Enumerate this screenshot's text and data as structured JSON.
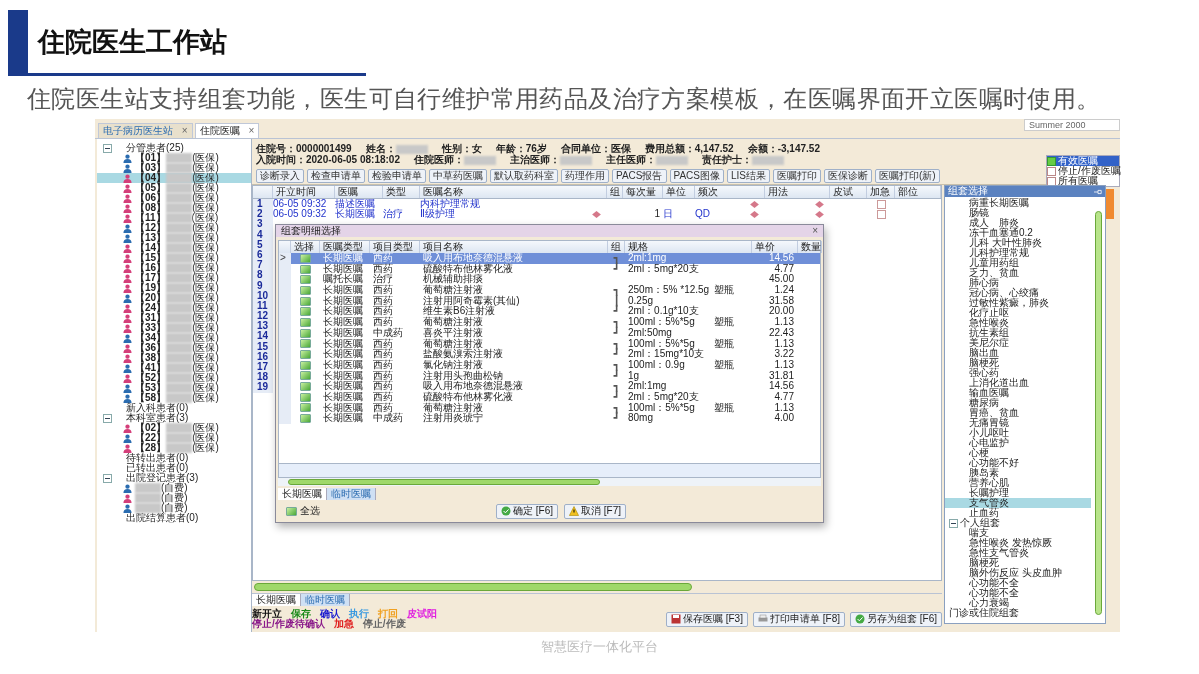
{
  "slide": {
    "title": "住院医生工作站",
    "subtitle": "住院医生站支持组套功能，医生可自行维护常用药品及治疗方案模板，在医嘱界面开立医嘱时使用。",
    "caption": "智慧医疗一体化平台"
  },
  "app": {
    "tabs": [
      {
        "label": "电子病历医生站",
        "close": "×",
        "selected": false
      },
      {
        "label": "住院医嘱",
        "close": "×",
        "selected": true
      }
    ],
    "theme_field": "Summer 2000",
    "patient_tree": [
      {
        "label": "分管患者(25)",
        "expanded": true,
        "children": [
          {
            "id": "【01】",
            "fee": "(医保)",
            "color": "#2b6cb0",
            "selected": false
          },
          {
            "id": "【03】",
            "fee": "(医保)",
            "color": "#2b6cb0",
            "selected": false
          },
          {
            "id": "【04】",
            "fee": "(医保)",
            "color": "#d43f7a",
            "selected": true
          },
          {
            "id": "【05】",
            "fee": "(医保)",
            "color": "#d43f7a",
            "selected": false
          },
          {
            "id": "【06】",
            "fee": "(医保)",
            "color": "#d43f7a",
            "selected": false
          },
          {
            "id": "【08】",
            "fee": "(医保)",
            "color": "#d43f7a",
            "selected": false
          },
          {
            "id": "【11】",
            "fee": "(医保)",
            "color": "#d43f7a",
            "selected": false
          },
          {
            "id": "【12】",
            "fee": "(医保)",
            "color": "#2b6cb0",
            "selected": false
          },
          {
            "id": "【13】",
            "fee": "(医保)",
            "color": "#2b6cb0",
            "selected": false
          },
          {
            "id": "【14】",
            "fee": "(医保)",
            "color": "#d43f7a",
            "selected": false
          },
          {
            "id": "【15】",
            "fee": "(医保)",
            "color": "#d43f7a",
            "selected": false
          },
          {
            "id": "【16】",
            "fee": "(医保)",
            "color": "#d43f7a",
            "selected": false
          },
          {
            "id": "【17】",
            "fee": "(医保)",
            "color": "#d43f7a",
            "selected": false
          },
          {
            "id": "【19】",
            "fee": "(医保)",
            "color": "#d43f7a",
            "selected": false
          },
          {
            "id": "【20】",
            "fee": "(医保)",
            "color": "#2b6cb0",
            "selected": false
          },
          {
            "id": "【24】",
            "fee": "(医保)",
            "color": "#d43f7a",
            "selected": false
          },
          {
            "id": "【31】",
            "fee": "(医保)",
            "color": "#d43f7a",
            "selected": false
          },
          {
            "id": "【33】",
            "fee": "(医保)",
            "color": "#d43f7a",
            "selected": false
          },
          {
            "id": "【34】",
            "fee": "(医保)",
            "color": "#2b6cb0",
            "selected": false
          },
          {
            "id": "【36】",
            "fee": "(医保)",
            "color": "#d43f7a",
            "selected": false
          },
          {
            "id": "【38】",
            "fee": "(医保)",
            "color": "#d43f7a",
            "selected": false
          },
          {
            "id": "【41】",
            "fee": "(医保)",
            "color": "#2b6cb0",
            "selected": false
          },
          {
            "id": "【52】",
            "fee": "(医保)",
            "color": "#d43f7a",
            "selected": false
          },
          {
            "id": "【53】",
            "fee": "(医保)",
            "color": "#2b6cb0",
            "selected": false
          },
          {
            "id": "【58】",
            "fee": "(医保)",
            "color": "#2b6cb0",
            "selected": false
          }
        ]
      },
      {
        "label": "新入科患者(0)"
      },
      {
        "label": "本科室患者(3)",
        "expanded": true,
        "children": [
          {
            "id": "【02】",
            "fee": "(医保)",
            "color": "#d43f7a",
            "selected": false
          },
          {
            "id": "【22】",
            "fee": "(医保)",
            "color": "#2b6cb0",
            "selected": false
          },
          {
            "id": "【28】",
            "fee": "(医保)",
            "color": "#d43f7a",
            "selected": false
          }
        ]
      },
      {
        "label": "待转出患者(0)"
      },
      {
        "label": "已转出患者(0)"
      },
      {
        "label": "出院登记患者(3)",
        "expanded": true,
        "children": [
          {
            "fee": "(自费)",
            "color": "#2b6cb0",
            "selected": false
          },
          {
            "fee": "(自费)",
            "color": "#d43f7a",
            "selected": false
          },
          {
            "fee": "(自费)",
            "color": "#2b6cb0",
            "selected": false
          }
        ]
      },
      {
        "label": "出院结算患者(0)"
      }
    ],
    "patient_info": [
      [
        {
          "label": "住院号：",
          "value": "0000001499"
        },
        {
          "label": "姓名：",
          "blurred": true
        },
        {
          "label": "性别：",
          "value": "女"
        },
        {
          "label": "年龄：",
          "value": "76岁"
        },
        {
          "label": "合同单位：",
          "value": "医保"
        },
        {
          "label": "费用总额：",
          "value": "4,147.52"
        },
        {
          "label": "余额：",
          "value": "-3,147.52"
        }
      ],
      [
        {
          "label": "入院时间：",
          "value": "2020-06-05 08:18:02"
        },
        {
          "label": "住院医师：",
          "blurred": true
        },
        {
          "label": "主治医师：",
          "blurred": true
        },
        {
          "label": "主任医师：",
          "blurred": true
        },
        {
          "label": "责任护士：",
          "blurred": true
        }
      ]
    ],
    "toolbar": [
      "诊断录入",
      "检查申请单",
      "检验申请单",
      "中草药医嘱",
      "默认取药科室",
      "药理作用",
      "PACS报告",
      "PACS图像",
      "LIS结果",
      "医嘱打印",
      "医保诊断",
      "医嘱打印(新)"
    ],
    "order_filters": [
      {
        "label": "有效医嘱",
        "checked": true,
        "selected": true
      },
      {
        "label": "停止/作废医嘱",
        "checked": false,
        "selected": false
      },
      {
        "label": "所有医嘱",
        "checked": false,
        "selected": false
      }
    ],
    "order_grid": {
      "columns": [
        "开立时间",
        "医嘱",
        "类型",
        "医嘱名称",
        "组",
        "每次量",
        "单位",
        "频次",
        "用法",
        "皮试",
        "加急",
        "部位"
      ],
      "rows": [
        {
          "num": "1",
          "time": "06-05 09:32",
          "order_type": "描述医嘱",
          "category": "",
          "name": "内科护理常规",
          "dose": "",
          "unit": "",
          "freq": "",
          "urgent": false
        },
        {
          "num": "2",
          "time": "06-05 09:32",
          "order_type": "长期医嘱",
          "category": "治疗",
          "name": "Ⅱ级护理",
          "dose": "1",
          "unit": "日",
          "freq": "QD",
          "urgent": false
        }
      ],
      "row_numbers": [
        "3",
        "4",
        "5",
        "6",
        "7",
        "8",
        "9",
        "10",
        "11",
        "12",
        "13",
        "14",
        "15",
        "16",
        "17",
        "18",
        "19"
      ],
      "tabs": [
        {
          "label": "长期医嘱",
          "selected": true
        },
        {
          "label": "临时医嘱",
          "selected": false
        }
      ]
    },
    "legend": [
      [
        {
          "label": "新开立",
          "color": "#111111"
        },
        {
          "label": "保存",
          "color": "#1a8a1a"
        },
        {
          "label": "确认",
          "color": "#1a1ad0"
        },
        {
          "label": "执行",
          "color": "#3a9ae0"
        },
        {
          "label": "打回",
          "color": "#f0a020"
        },
        {
          "label": "皮试阳",
          "color": "#e020e0"
        }
      ],
      [
        {
          "label": "停止/作废待确认",
          "color": "#8a1a8a"
        },
        {
          "label": "加急",
          "color": "#e02020"
        },
        {
          "label": "停止/作废",
          "color": "#666666"
        }
      ]
    ],
    "actions": [
      {
        "label": "保存医嘱 [F3]",
        "kind": "save"
      },
      {
        "label": "打印申请单 [F8]",
        "kind": "print"
      },
      {
        "label": "另存为组套 [F6]",
        "kind": "saveas"
      }
    ],
    "template_panel": {
      "title": "组套选择",
      "items": [
        {
          "label": "病重长期医嘱",
          "selected": false
        },
        {
          "label": "肠镜",
          "selected": false
        },
        {
          "label": "成人　肺炎",
          "selected": false
        },
        {
          "label": "冻干血塞通0.2",
          "selected": false
        },
        {
          "label": "儿科 大叶性肺炎",
          "selected": false
        },
        {
          "label": "儿科护理常规",
          "selected": false
        },
        {
          "label": "儿童用药组",
          "selected": false
        },
        {
          "label": "乏力、贫血",
          "selected": false
        },
        {
          "label": "肺心病",
          "selected": false
        },
        {
          "label": "冠心病、心绞痛",
          "selected": false
        },
        {
          "label": "过敏性紫癜，肺炎",
          "selected": false
        },
        {
          "label": "化疗止呕",
          "selected": false
        },
        {
          "label": "急性喉炎",
          "selected": false
        },
        {
          "label": "抗生素组",
          "selected": false
        },
        {
          "label": "美尼尔症",
          "selected": false
        },
        {
          "label": "脑出血",
          "selected": false
        },
        {
          "label": "脑梗死",
          "selected": false
        },
        {
          "label": "强心药",
          "selected": false
        },
        {
          "label": "上消化道出血",
          "selected": false
        },
        {
          "label": "输血医嘱",
          "selected": false
        },
        {
          "label": "糖尿病",
          "selected": false
        },
        {
          "label": "胃癌、贫血",
          "selected": false
        },
        {
          "label": "无痛胃镜",
          "selected": false
        },
        {
          "label": "小儿呕吐",
          "selected": false
        },
        {
          "label": "心电监护",
          "selected": false
        },
        {
          "label": "心梗",
          "selected": false
        },
        {
          "label": "心功能不好",
          "selected": false
        },
        {
          "label": "胰岛素",
          "selected": false
        },
        {
          "label": "营养心肌",
          "selected": false
        },
        {
          "label": "长嘱护理",
          "selected": false
        },
        {
          "label": "支气管炎",
          "selected": true
        },
        {
          "label": "止血药",
          "selected": false
        }
      ],
      "nodes": [
        {
          "label": "个人组套",
          "expanded": true,
          "children": [
            {
              "label": "喘支",
              "selected": false
            },
            {
              "label": "急性喉炎 发热惊厥",
              "selected": false
            },
            {
              "label": "急性支气管炎",
              "selected": false
            },
            {
              "label": "脑梗死",
              "selected": false
            },
            {
              "label": "脑外伤反应 头皮血肿",
              "selected": false
            },
            {
              "label": "心功能不全",
              "selected": false
            },
            {
              "label": "心功能不全",
              "selected": false
            },
            {
              "label": "心力衰竭",
              "selected": false
            }
          ]
        },
        {
          "label": "门诊或住院组套"
        }
      ]
    },
    "dialog": {
      "title": "组套明细选择",
      "close": "×",
      "columns": [
        "选择",
        "医嘱类型",
        "项目类型",
        "项目名称",
        "组",
        "规格",
        "单价",
        "数量"
      ],
      "current": ">",
      "rows": [
        {
          "selected": true,
          "checked": true,
          "order_type": "长期医嘱",
          "item_type": "西药",
          "name": "吸入用布地奈德混悬液",
          "group": "┓",
          "spec": "2ml:1mg",
          "package": "",
          "price": "14.56"
        },
        {
          "selected": false,
          "checked": true,
          "order_type": "长期医嘱",
          "item_type": "西药",
          "name": "硫酸特布他林雾化液",
          "group": "┛",
          "spec": "2ml：5mg*20支",
          "package": "",
          "price": "4.77"
        },
        {
          "selected": false,
          "checked": true,
          "order_type": "嘱托长嘱",
          "item_type": "治疗",
          "name": "机械辅助排痰",
          "group": "",
          "spec": "",
          "package": "",
          "price": "45.00"
        },
        {
          "selected": false,
          "checked": true,
          "order_type": "长期医嘱",
          "item_type": "西药",
          "name": "葡萄糖注射液",
          "group": "┓",
          "spec": "250m：5% *12.5g",
          "package": "塑瓶",
          "price": "1.24"
        },
        {
          "selected": false,
          "checked": true,
          "order_type": "长期医嘱",
          "item_type": "西药",
          "name": "注射用阿奇霉素(其仙)",
          "group": "┃",
          "spec": "0.25g",
          "package": "",
          "price": "31.58"
        },
        {
          "selected": false,
          "checked": true,
          "order_type": "长期医嘱",
          "item_type": "西药",
          "name": "维生素B6注射液",
          "group": "┛",
          "spec": "2ml：0.1g*10支",
          "package": "",
          "price": "20.00"
        },
        {
          "selected": false,
          "checked": true,
          "order_type": "长期医嘱",
          "item_type": "西药",
          "name": "葡萄糖注射液",
          "group": "┓",
          "spec": "100ml：5%*5g",
          "package": "塑瓶",
          "price": "1.13"
        },
        {
          "selected": false,
          "checked": true,
          "order_type": "长期医嘱",
          "item_type": "中成药",
          "name": "喜炎平注射液",
          "group": "┛",
          "spec": "2ml:50mg",
          "package": "",
          "price": "22.43"
        },
        {
          "selected": false,
          "checked": true,
          "order_type": "长期医嘱",
          "item_type": "西药",
          "name": "葡萄糖注射液",
          "group": "┓",
          "spec": "100ml：5%*5g",
          "package": "塑瓶",
          "price": "1.13"
        },
        {
          "selected": false,
          "checked": true,
          "order_type": "长期医嘱",
          "item_type": "西药",
          "name": "盐酸氨溴索注射液",
          "group": "┛",
          "spec": "2ml：15mg*10支",
          "package": "",
          "price": "3.22"
        },
        {
          "selected": false,
          "checked": true,
          "order_type": "长期医嘱",
          "item_type": "西药",
          "name": "氯化钠注射液",
          "group": "┓",
          "spec": "100ml：0.9g",
          "package": "塑瓶",
          "price": "1.13"
        },
        {
          "selected": false,
          "checked": true,
          "order_type": "长期医嘱",
          "item_type": "西药",
          "name": "注射用头孢曲松钠",
          "group": "┛",
          "spec": "1g",
          "package": "",
          "price": "31.81"
        },
        {
          "selected": false,
          "checked": true,
          "order_type": "长期医嘱",
          "item_type": "西药",
          "name": "吸入用布地奈德混悬液",
          "group": "┓",
          "spec": "2ml:1mg",
          "package": "",
          "price": "14.56"
        },
        {
          "selected": false,
          "checked": true,
          "order_type": "长期医嘱",
          "item_type": "西药",
          "name": "硫酸特布他林雾化液",
          "group": "┛",
          "spec": "2ml：5mg*20支",
          "package": "",
          "price": "4.77"
        },
        {
          "selected": false,
          "checked": true,
          "order_type": "长期医嘱",
          "item_type": "西药",
          "name": "葡萄糖注射液",
          "group": "┓",
          "spec": "100ml：5%*5g",
          "package": "塑瓶",
          "price": "1.13"
        },
        {
          "selected": false,
          "checked": true,
          "order_type": "长期医嘱",
          "item_type": "中成药",
          "name": "注射用炎琥宁",
          "group": "┛",
          "spec": "80mg",
          "package": "",
          "price": "4.00"
        }
      ],
      "tabs": [
        {
          "label": "长期医嘱",
          "selected": true
        },
        {
          "label": "临时医嘱",
          "selected": false
        }
      ],
      "select_all": {
        "label": "全选",
        "checked": true
      },
      "buttons": [
        {
          "label": "确定 [F6]",
          "kind": "ok"
        },
        {
          "label": "取消 [F7]",
          "kind": "warn"
        }
      ]
    }
  }
}
